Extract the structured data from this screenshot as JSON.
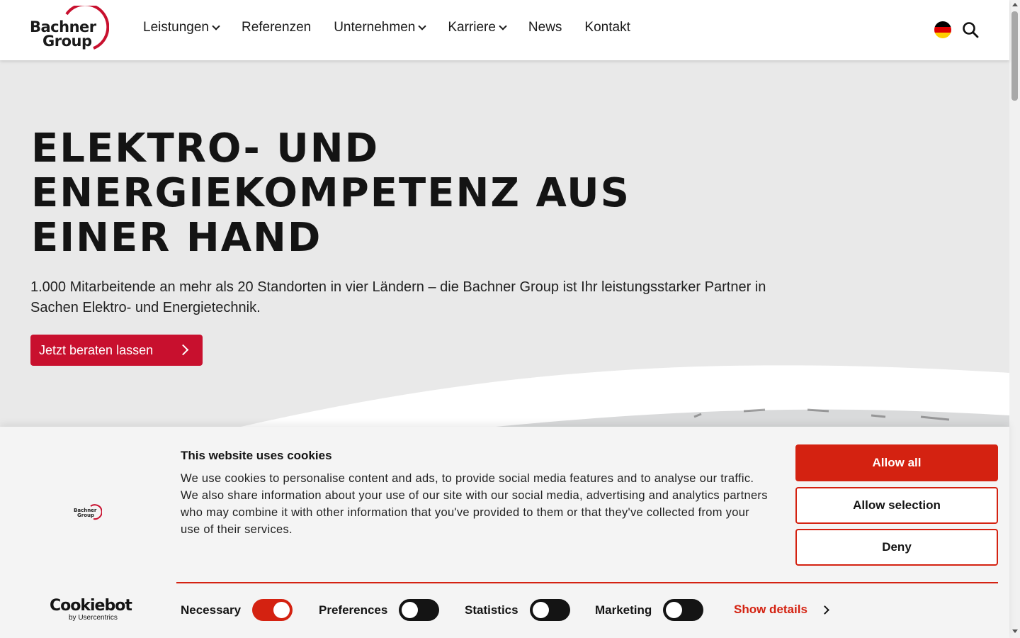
{
  "header": {
    "logo_line1": "Bachner",
    "logo_line2": "Group",
    "nav": [
      {
        "label": "Leistungen",
        "dropdown": true
      },
      {
        "label": "Referenzen",
        "dropdown": false
      },
      {
        "label": "Unternehmen",
        "dropdown": true
      },
      {
        "label": "Karriere",
        "dropdown": true
      },
      {
        "label": "News",
        "dropdown": false
      },
      {
        "label": "Kontakt",
        "dropdown": false
      }
    ],
    "language_icon": "flag-germany-icon",
    "search_icon": "search-icon"
  },
  "hero": {
    "title": "Elektro- und Energiekompetenz aus einer Hand",
    "text": "1.000 Mitarbeitende an mehr als 20 Standorten in vier Ländern – die Bachner Group ist Ihr leistungsstarker Partner in Sachen Elektro- und Energietechnik.",
    "cta_label": "Jetzt beraten lassen"
  },
  "cookie_banner": {
    "logo_line1": "Bachner",
    "logo_line2": "Group",
    "provider_name": "Cookiebot",
    "provider_sub": "by Usercentrics",
    "title": "This website uses cookies",
    "text": "We use cookies to personalise content and ads, to provide social media features and to analyse our traffic. We also share information about your use of our site with our social media, advertising and analytics partners who may combine it with other information that you've provided to them or that they've collected from your use of their services.",
    "buttons": {
      "allow_all": "Allow all",
      "allow_selection": "Allow selection",
      "deny": "Deny"
    },
    "consents": [
      {
        "label": "Necessary",
        "enabled": true
      },
      {
        "label": "Preferences",
        "enabled": false
      },
      {
        "label": "Statistics",
        "enabled": false
      },
      {
        "label": "Marketing",
        "enabled": false
      }
    ],
    "show_details": "Show details"
  },
  "colors": {
    "brand_red": "#c8102e",
    "cookie_red": "#d42211",
    "hero_bg": "#e9e9e9"
  }
}
